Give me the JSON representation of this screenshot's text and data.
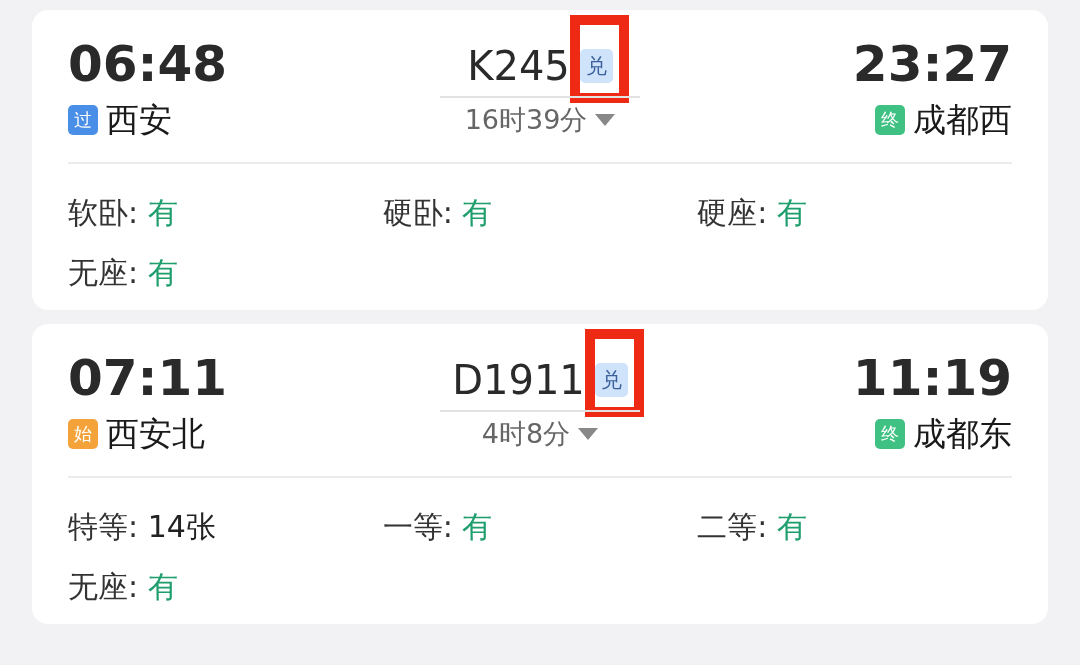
{
  "trains": [
    {
      "depart_time": "06:48",
      "from": {
        "badge": "过",
        "color": "#4a8fe7",
        "station": "西安"
      },
      "train_no": "K245",
      "exchange_badge": "兑",
      "highlighted": true,
      "duration": "16时39分",
      "arrive_time": "23:27",
      "to": {
        "badge": "终",
        "color": "#3fc183",
        "station": "成都西"
      },
      "seats": [
        {
          "label": "软卧:",
          "value": "有",
          "color": "#1d9e6c"
        },
        {
          "label": "硬卧:",
          "value": "有",
          "color": "#1d9e6c"
        },
        {
          "label": "硬座:",
          "value": "有",
          "color": "#1d9e6c"
        },
        {
          "label": "无座:",
          "value": "有",
          "color": "#1d9e6c"
        }
      ]
    },
    {
      "depart_time": "07:11",
      "from": {
        "badge": "始",
        "color": "#f3a33a",
        "station": "西安北"
      },
      "train_no": "D1911",
      "exchange_badge": "兑",
      "highlighted": true,
      "duration": "4时8分",
      "arrive_time": "11:19",
      "to": {
        "badge": "终",
        "color": "#3fc183",
        "station": "成都东"
      },
      "seats": [
        {
          "label": "特等:",
          "value": "14张",
          "color": "#222222"
        },
        {
          "label": "一等:",
          "value": "有",
          "color": "#1d9e6c"
        },
        {
          "label": "二等:",
          "value": "有",
          "color": "#1d9e6c"
        },
        {
          "label": "无座:",
          "value": "有",
          "color": "#1d9e6c"
        }
      ]
    }
  ]
}
